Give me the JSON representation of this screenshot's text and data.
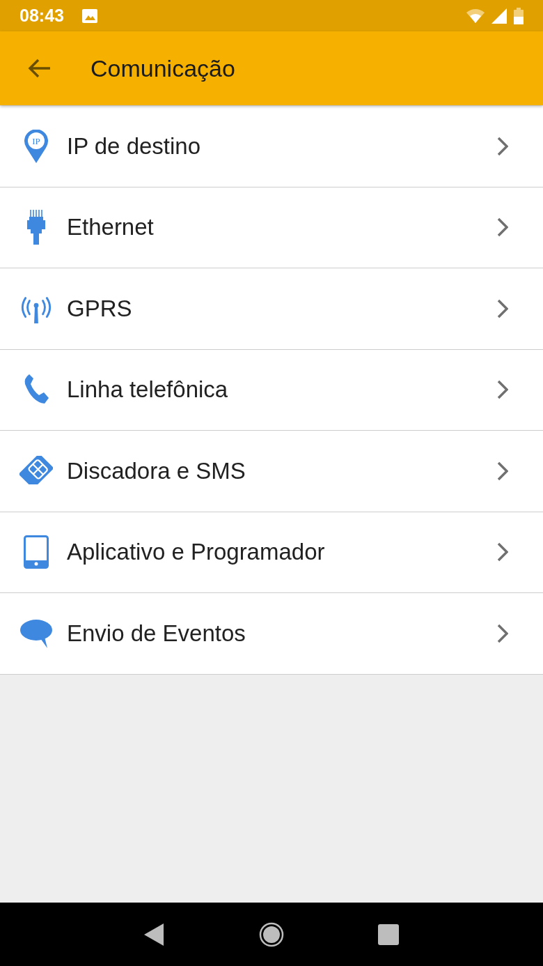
{
  "status_bar": {
    "time": "08:43"
  },
  "app_bar": {
    "title": "Comunicação"
  },
  "items": [
    {
      "icon_label": "IP",
      "label": "IP de destino"
    },
    {
      "label": "Ethernet"
    },
    {
      "label": "GPRS"
    },
    {
      "label": "Linha telefônica"
    },
    {
      "label": "Discadora e SMS"
    },
    {
      "label": "Aplicativo e Programador"
    },
    {
      "label": "Envio de Eventos"
    }
  ]
}
